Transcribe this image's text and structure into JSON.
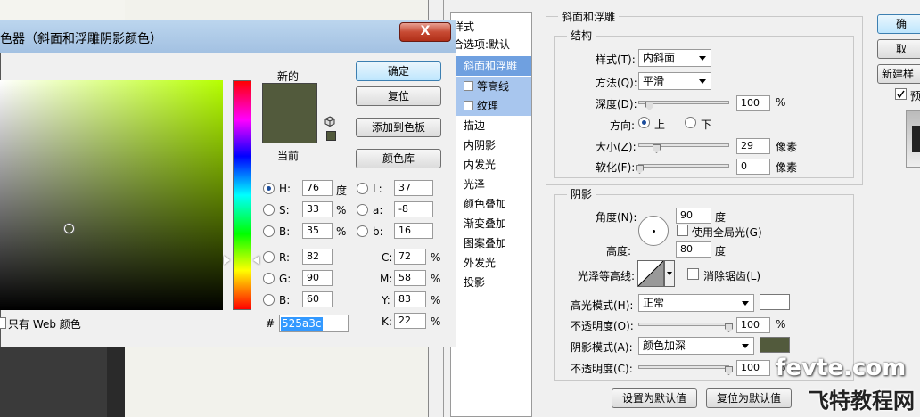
{
  "picker": {
    "title": "色器（斜面和浮雕阴影颜色）",
    "close_glyph": "X",
    "new_label": "新的",
    "current_label": "当前",
    "buttons": {
      "ok": "确定",
      "reset": "复位",
      "add_swatch": "添加到色板",
      "color_lib": "颜色库"
    },
    "web_only_label": "只有 Web 颜色",
    "hex_prefix": "#",
    "hex": "525a3c",
    "hsb": {
      "h_label": "H:",
      "h": "76",
      "h_unit": "度",
      "s_label": "S:",
      "s": "33",
      "s_unit": "%",
      "b_label": "B:",
      "b": "35",
      "b_unit": "%"
    },
    "rgb": {
      "r_label": "R:",
      "r": "82",
      "g_label": "G:",
      "g": "90",
      "b_label": "B:",
      "b": "60"
    },
    "lab": {
      "l_label": "L:",
      "l": "37",
      "a_label": "a:",
      "a": "-8",
      "b_label": "b:",
      "b": "16"
    },
    "cmyk": {
      "c_label": "C:",
      "c": "72",
      "m_label": "M:",
      "m": "58",
      "y_label": "Y:",
      "y": "83",
      "k_label": "K:",
      "k": "22",
      "unit": "%"
    },
    "color": "#525a3c"
  },
  "layer_style": {
    "list": {
      "header": "样式",
      "items": [
        "合选项:默认",
        "斜面和浮雕",
        "等高线",
        "纹理",
        "描边",
        "内阴影",
        "内发光",
        "光泽",
        "颜色叠加",
        "渐变叠加",
        "图案叠加",
        "外发光",
        "投影"
      ]
    },
    "bevel": {
      "title": "斜面和浮雕",
      "structure_title": "结构",
      "style_label": "样式(T):",
      "style_value": "内斜面",
      "method_label": "方法(Q):",
      "method_value": "平滑",
      "depth_label": "深度(D):",
      "depth_value": "100",
      "depth_unit": "%",
      "direction_label": "方向:",
      "dir_up": "上",
      "dir_down": "下",
      "size_label": "大小(Z):",
      "size_value": "29",
      "size_unit": "像素",
      "soften_label": "软化(F):",
      "soften_value": "0",
      "soften_unit": "像素"
    },
    "shading": {
      "title": "阴影",
      "angle_label": "角度(N):",
      "angle_value": "90",
      "angle_unit": "度",
      "global_light": "使用全局光(G)",
      "altitude_label": "高度:",
      "altitude_value": "80",
      "altitude_unit": "度",
      "gloss_label": "光泽等高线:",
      "antialias": "消除锯齿(L)",
      "highlight_label": "高光模式(H):",
      "highlight_value": "正常",
      "hl_opacity_label": "不透明度(O):",
      "hl_opacity_value": "100",
      "hl_opacity_unit": "%",
      "shadow_label": "阴影模式(A):",
      "shadow_value": "颜色加深",
      "sh_opacity_label": "不透明度(C):",
      "sh_opacity_value": "100",
      "sh_opacity_unit": "%",
      "highlight_color": "#ffffff",
      "shadow_color": "#525a3c"
    },
    "set_default": "设置为默认值",
    "reset_default": "复位为默认值",
    "right_buttons": {
      "ok": "确",
      "cancel": "取",
      "new_style": "新建样",
      "preview": "预"
    }
  },
  "watermark": {
    "site": "fevte.com",
    "name": "飞特教程网"
  }
}
